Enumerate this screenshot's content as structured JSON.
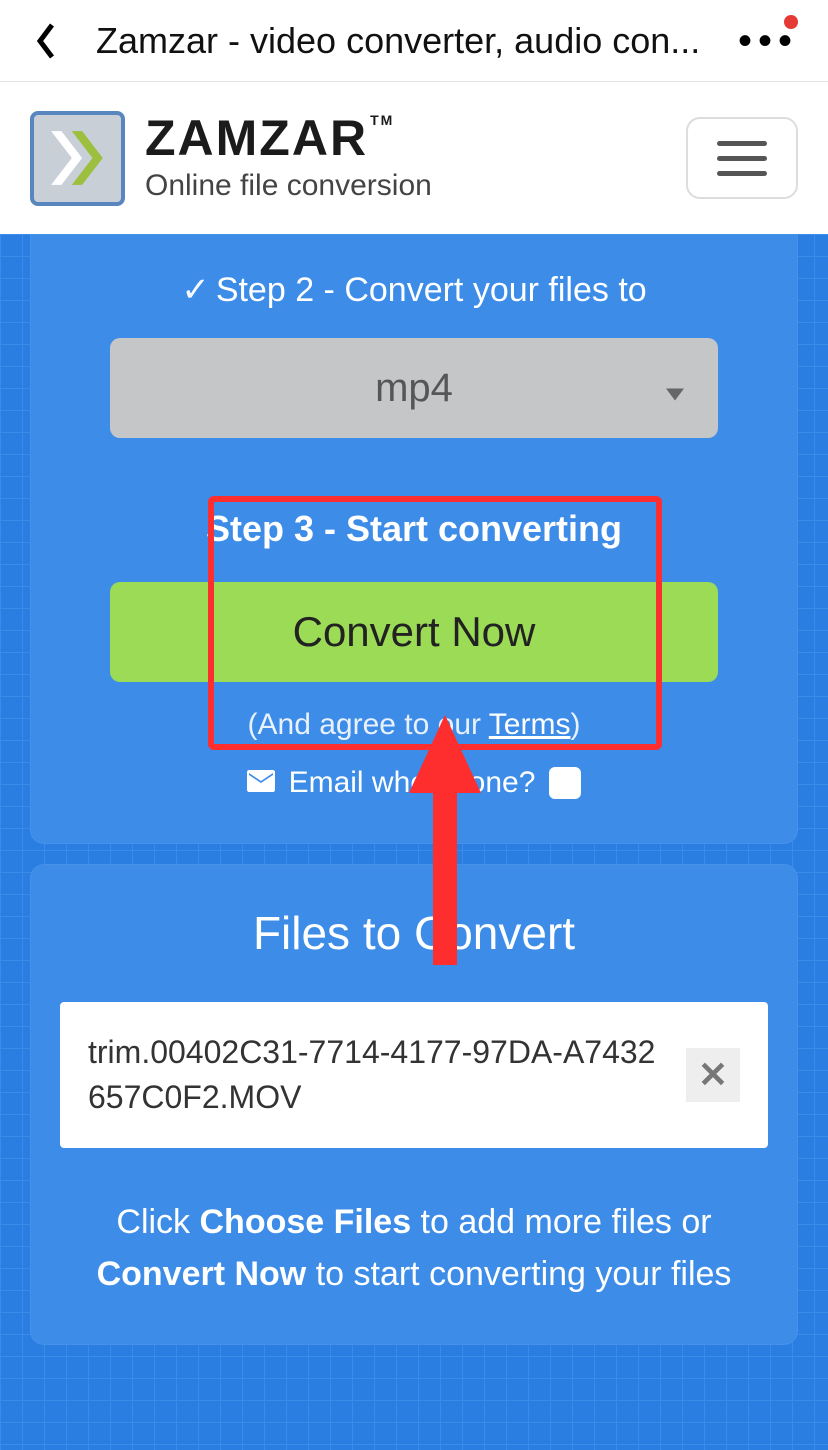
{
  "browser": {
    "title": "Zamzar - video converter, audio con..."
  },
  "brand": {
    "name": "ZAMZAR",
    "tm": "TM",
    "tagline": "Online file conversion"
  },
  "step2": {
    "label": "Step 2 - Convert your files to",
    "selected_format": "mp4"
  },
  "step3": {
    "title": "Step 3 - Start converting",
    "button": "Convert Now",
    "terms_prefix": "(And agree to our ",
    "terms_link": "Terms",
    "terms_suffix": ")",
    "email_label": "Email when done?"
  },
  "files": {
    "title": "Files to Convert",
    "items": [
      {
        "name": "trim.00402C31-7714-4177-97DA-A7432657C0F2.MOV"
      }
    ],
    "hint_1": "Click ",
    "hint_b1": "Choose Files",
    "hint_2": " to add more files or ",
    "hint_b2": "Convert Now",
    "hint_3": " to start converting your files"
  }
}
